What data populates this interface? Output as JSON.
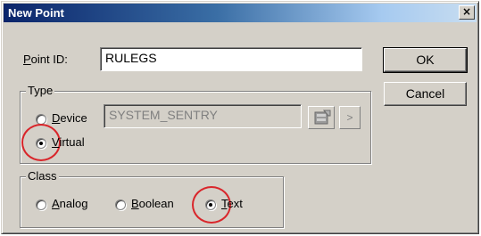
{
  "window": {
    "title": "New Point",
    "close_glyph": "×"
  },
  "point_id": {
    "label_prefix": "",
    "label_mnemonic": "P",
    "label_rest": "oint ID:",
    "value": "RULEGS"
  },
  "buttons": {
    "ok": "OK",
    "cancel": "Cancel"
  },
  "type_group": {
    "legend": "Type",
    "device_mnemonic": "D",
    "device_rest": "evice",
    "device_value": "SYSTEM_SENTRY",
    "virtual_mnemonic": "V",
    "virtual_rest": "irtual",
    "selected": "virtual",
    "browse_icon": "database-icon",
    "arrow_glyph": ">"
  },
  "class_group": {
    "legend": "Class",
    "analog_mnemonic": "A",
    "analog_rest": "nalog",
    "boolean_mnemonic": "B",
    "boolean_rest": "oolean",
    "text_mnemonic": "T",
    "text_rest": "ext",
    "selected": "text"
  },
  "colors": {
    "highlight_circle": "#d9262b",
    "dialog_face": "#d4d0c8",
    "title_start": "#0a246a"
  }
}
